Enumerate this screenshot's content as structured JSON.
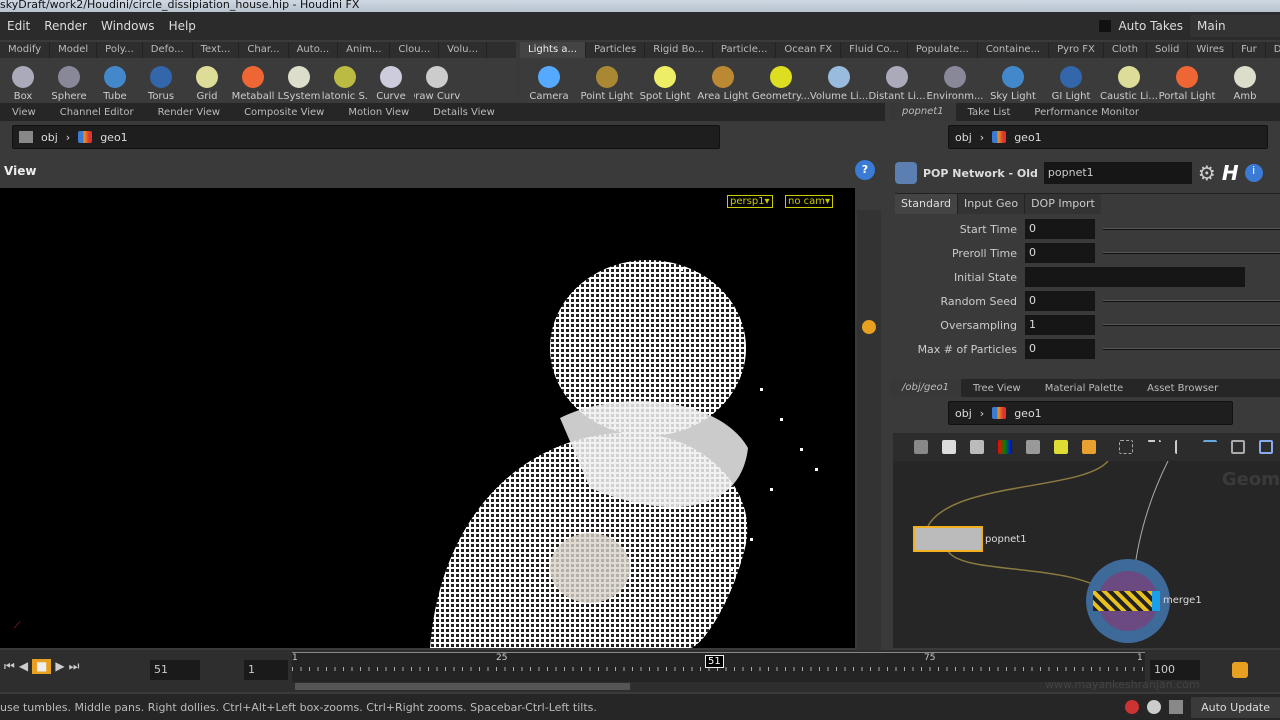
{
  "title": "skyDraft/work2/Houdini/circle_dissipiation_house.hip - Houdini FX",
  "menu": [
    "Edit",
    "Render",
    "Windows",
    "Help"
  ],
  "auto_takes": "Auto Takes",
  "take": "Main",
  "shelf_left": {
    "tabs": [
      "Modify",
      "Model",
      "Poly...",
      "Defo...",
      "Text...",
      "Char...",
      "Auto...",
      "Anim...",
      "Clou...",
      "Volu..."
    ],
    "tools": [
      "Box",
      "Sphere",
      "Tube",
      "Torus",
      "Grid",
      "Metaball",
      "LSystem",
      "Platonic S...",
      "Curve",
      "Draw Curve"
    ]
  },
  "shelf_right": {
    "tabs": [
      "Lights a...",
      "Particles",
      "Rigid Bo...",
      "Particle...",
      "Ocean FX",
      "Fluid Co...",
      "Populate...",
      "Containe...",
      "Pyro FX",
      "Cloth",
      "Solid",
      "Wires",
      "Fur",
      "Drive Si..."
    ],
    "tools": [
      "Camera",
      "Point Light",
      "Spot Light",
      "Area Light",
      "Geometry...",
      "Volume Li...",
      "Distant Li...",
      "Environm...",
      "Sky Light",
      "GI Light",
      "Caustic Li...",
      "Portal Light",
      "Amb"
    ]
  },
  "left_panes": [
    "View",
    "Channel Editor",
    "Render View",
    "Composite View",
    "Motion View",
    "Details View"
  ],
  "path": {
    "obj": "obj",
    "geo": "geo1"
  },
  "viewport": {
    "title": "View",
    "persp": "persp1▾",
    "cam": "no cam▾"
  },
  "right_panes": [
    "popnet1",
    "Take List",
    "Performance Monitor"
  ],
  "params": {
    "type": "POP Network - Old",
    "name": "popnet1",
    "tabs": [
      "Standard",
      "Input Geo",
      "DOP Import"
    ],
    "rows": [
      {
        "label": "Start Time",
        "value": "0"
      },
      {
        "label": "Preroll Time",
        "value": "0"
      },
      {
        "label": "Initial State",
        "value": ""
      },
      {
        "label": "Random Seed",
        "value": "0"
      },
      {
        "label": "Oversampling",
        "value": "1"
      },
      {
        "label": "Max # of Particles",
        "value": "0"
      }
    ]
  },
  "net_panes": [
    "/obj/geo1",
    "Tree View",
    "Material Palette",
    "Asset Browser"
  ],
  "network": {
    "nodes": [
      "popnet1",
      "merge1"
    ],
    "watermark": "Geom"
  },
  "timeline": {
    "frame": "51",
    "start": "1",
    "end": "100",
    "ticks": [
      "1",
      "25",
      "51",
      "75",
      "1"
    ],
    "current": 51
  },
  "status": "use tumbles. Middle pans. Right dollies. Ctrl+Alt+Left box-zooms. Ctrl+Right zooms. Spacebar-Ctrl-Left tilts.",
  "watermark": "www.mayankeshranjan.com",
  "auto_update": "Auto Update"
}
